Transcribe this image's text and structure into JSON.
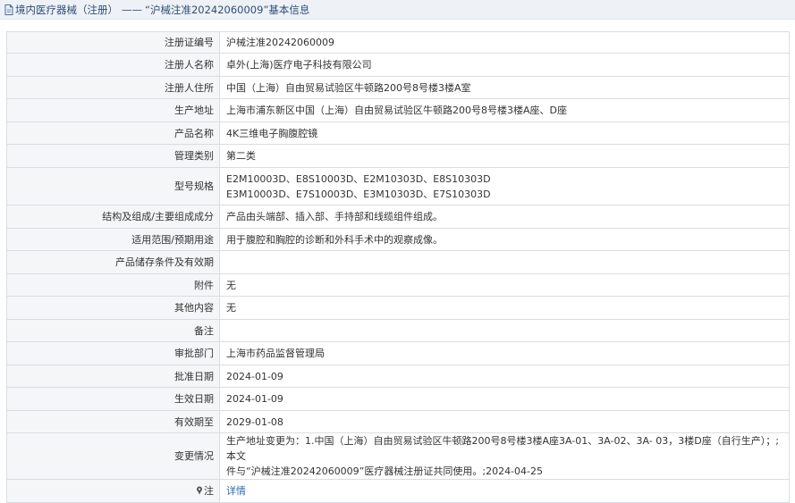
{
  "header": {
    "category": "境内医疗器械（注册）",
    "separator": "——",
    "title": "“沪械注准20242060009”基本信息"
  },
  "rows": [
    {
      "label": "注册证编号",
      "value": "沪械注准20242060009"
    },
    {
      "label": "注册人名称",
      "value": "卓外(上海)医疗电子科技有限公司"
    },
    {
      "label": "注册人住所",
      "value": "中国（上海）自由贸易试验区牛顿路200号8号楼3楼A室"
    },
    {
      "label": "生产地址",
      "value": "上海市浦东新区中国（上海）自由贸易试验区牛顿路200号8号楼3楼A座、D座"
    },
    {
      "label": "产品名称",
      "value": "4K三维电子胸腹腔镜"
    },
    {
      "label": "管理类别",
      "value": "第二类"
    },
    {
      "label": "型号规格",
      "lines": [
        "E2M10003D、E8S10003D、E2M10303D、E8S10303D",
        "E3M10003D、E7S10003D、E3M10303D、E7S10303D"
      ]
    },
    {
      "label": "结构及组成/主要组成成分",
      "value": "产品由头端部、插入部、手持部和线缆组件组成。"
    },
    {
      "label": "适用范围/预期用途",
      "value": "用于腹腔和胸腔的诊断和外科手术中的观察成像。"
    },
    {
      "label": "产品储存条件及有效期",
      "value": ""
    },
    {
      "label": "附件",
      "value": "无"
    },
    {
      "label": "其他内容",
      "value": "无"
    },
    {
      "label": "备注",
      "value": ""
    },
    {
      "label": "审批部门",
      "value": "上海市药品监督管理局"
    },
    {
      "label": "批准日期",
      "value": "2024-01-09"
    },
    {
      "label": "生效日期",
      "value": "2024-01-09"
    },
    {
      "label": "有效期至",
      "value": "2029-01-08"
    },
    {
      "label": "变更情况",
      "lines": [
        "生产地址变更为：1.中国（上海）自由贸易试验区牛顿路200号8号楼3楼A座3A-01、3A-02、3A- 03，3楼D座（自行生产）；;本文",
        "件与“沪械注准20242060009”医疗器械注册证共同使用。;2024-04-25"
      ]
    }
  ],
  "note": {
    "label": "注",
    "link": "详情",
    "icon": "pin-icon"
  }
}
